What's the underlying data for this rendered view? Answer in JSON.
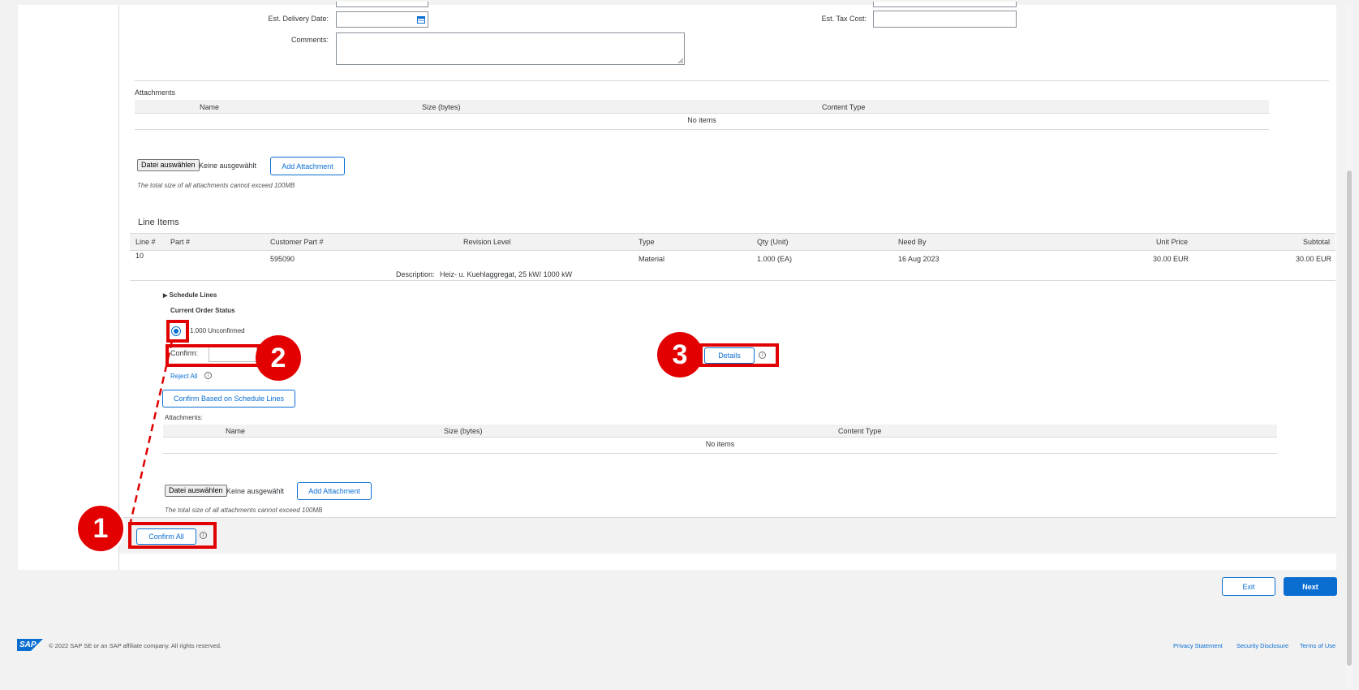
{
  "header_fields": {
    "est_delivery_date_label": "Est. Delivery Date:",
    "comments_label": "Comments:",
    "est_tax_cost_label": "Est. Tax Cost:"
  },
  "attachments_section": {
    "title": "Attachments",
    "columns": [
      "Name",
      "Size (bytes)",
      "Content Type"
    ],
    "empty_text": "No items",
    "choose_file_label": "Datei auswählen",
    "no_file_text": "Keine ausgewählt",
    "add_button": "Add Attachment",
    "size_note": "The total size of all attachments cannot exceed 100MB"
  },
  "line_items": {
    "title": "Line Items",
    "columns": [
      "Line #",
      "Part #",
      "Customer Part #",
      "Revision Level",
      "Type",
      "Qty (Unit)",
      "Need By",
      "Unit Price",
      "Subtotal"
    ],
    "row": {
      "line_no": "10",
      "part_no": "",
      "customer_part_no": "595090",
      "revision_level": "",
      "type": "Material",
      "qty": "1.000 (EA)",
      "need_by": "16 Aug 2023",
      "unit_price": "30.00 EUR",
      "subtotal": "30.00 EUR"
    },
    "description_label": "Description:",
    "description_value": "Heiz- u. Kuehlaggregat, 25 kW/ 1000 kW"
  },
  "schedule": {
    "toggle_label": "Schedule Lines",
    "status_title": "Current Order Status",
    "status_value": "1.000 Unconfirmed",
    "confirm_label": "Confirm:",
    "confirm_value": "",
    "reject_all": "Reject All",
    "details_button": "Details",
    "confirm_schedule_button": "Confirm Based on Schedule Lines"
  },
  "item_attachments": {
    "title": "Attachments:",
    "columns": [
      "Name",
      "Size (bytes)",
      "Content Type"
    ],
    "empty_text": "No items",
    "choose_file_label": "Datei auswählen",
    "no_file_text": "Keine ausgewählt",
    "add_button": "Add Attachment",
    "size_note": "The total size of all attachments cannot exceed 100MB"
  },
  "footer_actions": {
    "confirm_all": "Confirm All",
    "exit": "Exit",
    "next": "Next"
  },
  "annotations": {
    "badge_1": "1",
    "badge_2": "2",
    "badge_3": "3"
  },
  "page_footer": {
    "logo_text": "SAP",
    "copyright": "© 2022 SAP SE or an SAP affiliate company. All rights reserved.",
    "links": [
      "Privacy Statement",
      "Security Disclosure",
      "Terms of Use"
    ]
  },
  "colors": {
    "accent": "#0a6ed1",
    "annotation_red": "#e30000"
  }
}
